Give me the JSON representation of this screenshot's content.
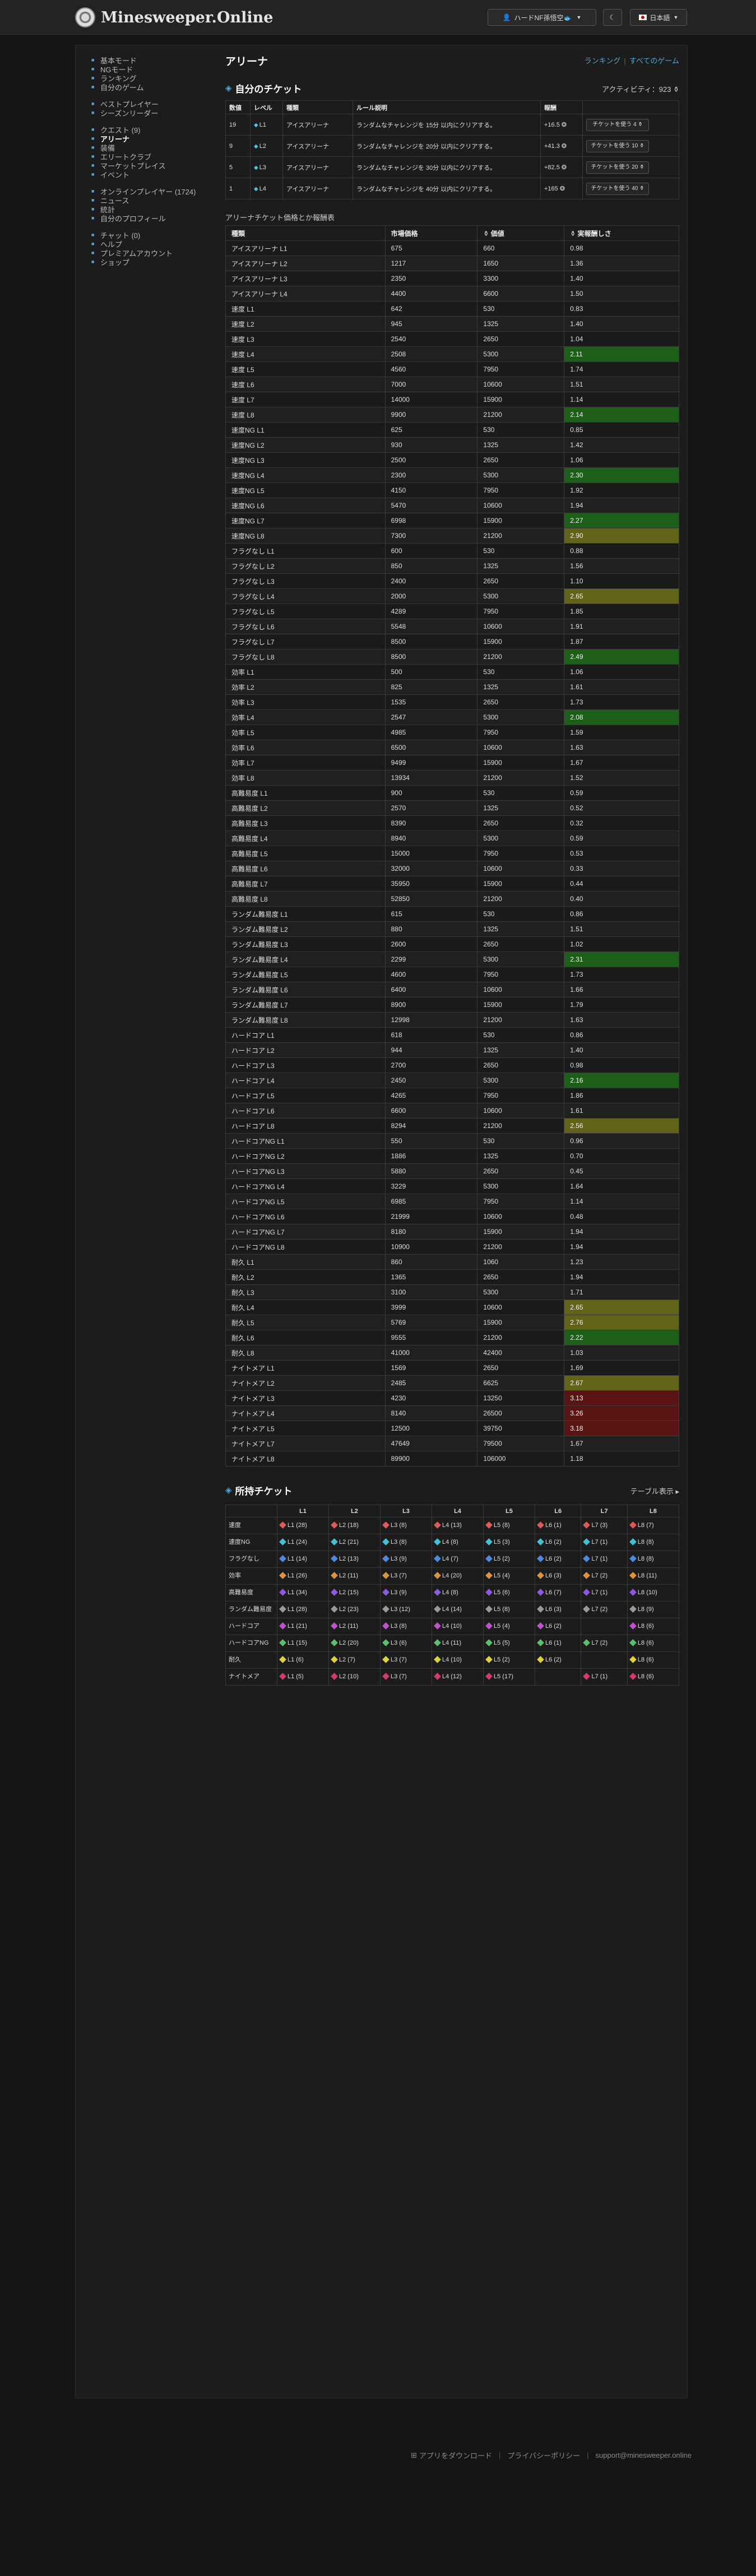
{
  "header": {
    "site_name": "Minesweeper.Online",
    "user_label": "ハードNF孫悟空🐟",
    "theme_icon": "moon-icon",
    "lang_label": "日本語"
  },
  "sidebar": {
    "groups": [
      [
        {
          "label": "基本モード",
          "icon": "bullet"
        },
        {
          "label": "NGモード",
          "icon": "bullet"
        },
        {
          "label": "ランキング",
          "icon": "bullet"
        },
        {
          "label": "自分のゲーム",
          "icon": "bullet"
        }
      ],
      [
        {
          "label": "ベストプレイヤー",
          "icon": "bullet"
        },
        {
          "label": "シーズンリーダー",
          "icon": "bullet"
        }
      ],
      [
        {
          "label": "クエスト (9)",
          "icon": "bullet"
        },
        {
          "label": "アリーナ",
          "icon": "bullet",
          "active": true
        },
        {
          "label": "装備",
          "icon": "bullet"
        },
        {
          "label": "エリートクラブ",
          "icon": "bullet"
        },
        {
          "label": "マーケットプレイス",
          "icon": "bullet"
        },
        {
          "label": "イベント",
          "icon": "bullet"
        }
      ],
      [
        {
          "label": "オンラインプレイヤー (1724)",
          "icon": "bullet"
        },
        {
          "label": "ニュース",
          "icon": "bullet"
        },
        {
          "label": "統計",
          "icon": "bullet"
        },
        {
          "label": "自分のプロフィール",
          "icon": "bullet"
        }
      ],
      [
        {
          "label": "チャット (0)",
          "icon": "bullet"
        },
        {
          "label": "ヘルプ",
          "icon": "bullet"
        },
        {
          "label": "プレミアムアカウント",
          "icon": "bullet"
        },
        {
          "label": "ショップ",
          "icon": "bullet"
        }
      ]
    ]
  },
  "main": {
    "page_title": "アリーナ",
    "links": {
      "ranking": "ランキング",
      "sep": "|",
      "all_games": "すべてのゲーム"
    },
    "my_tickets_title": "自分のチケット",
    "activity": "アクティビティ：923 ⚱",
    "quest_headers": [
      "数値",
      "レベル",
      "種類",
      "ルール説明",
      "報酬",
      ""
    ],
    "quests": [
      {
        "num": "19",
        "level": "L1",
        "kind": "アイスアリーナ",
        "desc": "ランダムなチャレンジを 15分 以内にクリアする。",
        "reward": "+16.5",
        "button": "チケットを使う 4 ⚱"
      },
      {
        "num": "9",
        "level": "L2",
        "kind": "アイスアリーナ",
        "desc": "ランダムなチャレンジを 20分 以内にクリアする。",
        "reward": "+41.3",
        "button": "チケットを使う 10 ⚱"
      },
      {
        "num": "5",
        "level": "L3",
        "kind": "アイスアリーナ",
        "desc": "ランダムなチャレンジを 30分 以内にクリアする。",
        "reward": "+82.5",
        "button": "チケットを使う 20 ⚱"
      },
      {
        "num": "1",
        "level": "L4",
        "kind": "アイスアリーナ",
        "desc": "ランダムなチャレンジを 40分 以内にクリアする。",
        "reward": "+165",
        "button": "チケットを使う 40 ⚱"
      }
    ],
    "ratio_subtitle": "アリーナチケット価格とか報酬表",
    "ratio_headers": [
      "種類",
      "市場価格",
      "⚱ 価値",
      "⚱ 実報酬しさ"
    ],
    "ratio_rows": [
      [
        "アイスアリーナ L1",
        "675",
        "660",
        "0.98",
        ""
      ],
      [
        "アイスアリーナ L2",
        "1217",
        "1650",
        "1.36",
        ""
      ],
      [
        "アイスアリーナ L3",
        "2350",
        "3300",
        "1.40",
        ""
      ],
      [
        "アイスアリーナ L4",
        "4400",
        "6600",
        "1.50",
        ""
      ],
      [
        "速度 L1",
        "642",
        "530",
        "0.83",
        ""
      ],
      [
        "速度 L2",
        "945",
        "1325",
        "1.40",
        ""
      ],
      [
        "速度 L3",
        "2540",
        "2650",
        "1.04",
        ""
      ],
      [
        "速度 L4",
        "2508",
        "5300",
        "2.11",
        "green"
      ],
      [
        "速度 L5",
        "4560",
        "7950",
        "1.74",
        ""
      ],
      [
        "速度 L6",
        "7000",
        "10600",
        "1.51",
        ""
      ],
      [
        "速度 L7",
        "14000",
        "15900",
        "1.14",
        ""
      ],
      [
        "速度 L8",
        "9900",
        "21200",
        "2.14",
        "green"
      ],
      [
        "速度NG L1",
        "625",
        "530",
        "0.85",
        ""
      ],
      [
        "速度NG L2",
        "930",
        "1325",
        "1.42",
        ""
      ],
      [
        "速度NG L3",
        "2500",
        "2650",
        "1.06",
        ""
      ],
      [
        "速度NG L4",
        "2300",
        "5300",
        "2.30",
        "green"
      ],
      [
        "速度NG L5",
        "4150",
        "7950",
        "1.92",
        ""
      ],
      [
        "速度NG L6",
        "5470",
        "10600",
        "1.94",
        ""
      ],
      [
        "速度NG L7",
        "6998",
        "15900",
        "2.27",
        "green"
      ],
      [
        "速度NG L8",
        "7300",
        "21200",
        "2.90",
        "olive"
      ],
      [
        "フラグなし L1",
        "600",
        "530",
        "0.88",
        ""
      ],
      [
        "フラグなし L2",
        "850",
        "1325",
        "1.56",
        ""
      ],
      [
        "フラグなし L3",
        "2400",
        "2650",
        "1.10",
        ""
      ],
      [
        "フラグなし L4",
        "2000",
        "5300",
        "2.65",
        "olive"
      ],
      [
        "フラグなし L5",
        "4289",
        "7950",
        "1.85",
        ""
      ],
      [
        "フラグなし L6",
        "5548",
        "10600",
        "1.91",
        ""
      ],
      [
        "フラグなし L7",
        "8500",
        "15900",
        "1.87",
        ""
      ],
      [
        "フラグなし L8",
        "8500",
        "21200",
        "2.49",
        "green"
      ],
      [
        "効率 L1",
        "500",
        "530",
        "1.06",
        ""
      ],
      [
        "効率 L2",
        "825",
        "1325",
        "1.61",
        ""
      ],
      [
        "効率 L3",
        "1535",
        "2650",
        "1.73",
        ""
      ],
      [
        "効率 L4",
        "2547",
        "5300",
        "2.08",
        "green"
      ],
      [
        "効率 L5",
        "4985",
        "7950",
        "1.59",
        ""
      ],
      [
        "効率 L6",
        "6500",
        "10600",
        "1.63",
        ""
      ],
      [
        "効率 L7",
        "9499",
        "15900",
        "1.67",
        ""
      ],
      [
        "効率 L8",
        "13934",
        "21200",
        "1.52",
        ""
      ],
      [
        "高難易度 L1",
        "900",
        "530",
        "0.59",
        ""
      ],
      [
        "高難易度 L2",
        "2570",
        "1325",
        "0.52",
        ""
      ],
      [
        "高難易度 L3",
        "8390",
        "2650",
        "0.32",
        ""
      ],
      [
        "高難易度 L4",
        "8940",
        "5300",
        "0.59",
        ""
      ],
      [
        "高難易度 L5",
        "15000",
        "7950",
        "0.53",
        ""
      ],
      [
        "高難易度 L6",
        "32000",
        "10600",
        "0.33",
        ""
      ],
      [
        "高難易度 L7",
        "35950",
        "15900",
        "0.44",
        ""
      ],
      [
        "高難易度 L8",
        "52850",
        "21200",
        "0.40",
        ""
      ],
      [
        "ランダム難易度 L1",
        "615",
        "530",
        "0.86",
        ""
      ],
      [
        "ランダム難易度 L2",
        "880",
        "1325",
        "1.51",
        ""
      ],
      [
        "ランダム難易度 L3",
        "2600",
        "2650",
        "1.02",
        ""
      ],
      [
        "ランダム難易度 L4",
        "2299",
        "5300",
        "2.31",
        "green"
      ],
      [
        "ランダム難易度 L5",
        "4600",
        "7950",
        "1.73",
        ""
      ],
      [
        "ランダム難易度 L6",
        "6400",
        "10600",
        "1.66",
        ""
      ],
      [
        "ランダム難易度 L7",
        "8900",
        "15900",
        "1.79",
        ""
      ],
      [
        "ランダム難易度 L8",
        "12998",
        "21200",
        "1.63",
        ""
      ],
      [
        "ハードコア L1",
        "618",
        "530",
        "0.86",
        ""
      ],
      [
        "ハードコア L2",
        "944",
        "1325",
        "1.40",
        ""
      ],
      [
        "ハードコア L3",
        "2700",
        "2650",
        "0.98",
        ""
      ],
      [
        "ハードコア L4",
        "2450",
        "5300",
        "2.16",
        "green"
      ],
      [
        "ハードコア L5",
        "4265",
        "7950",
        "1.86",
        ""
      ],
      [
        "ハードコア L6",
        "6600",
        "10600",
        "1.61",
        ""
      ],
      [
        "ハードコア L8",
        "8294",
        "21200",
        "2.56",
        "olive"
      ],
      [
        "ハードコアNG L1",
        "550",
        "530",
        "0.96",
        ""
      ],
      [
        "ハードコアNG L2",
        "1886",
        "1325",
        "0.70",
        ""
      ],
      [
        "ハードコアNG L3",
        "5880",
        "2650",
        "0.45",
        ""
      ],
      [
        "ハードコアNG L4",
        "3229",
        "5300",
        "1.64",
        ""
      ],
      [
        "ハードコアNG L5",
        "6985",
        "7950",
        "1.14",
        ""
      ],
      [
        "ハードコアNG L6",
        "21999",
        "10600",
        "0.48",
        ""
      ],
      [
        "ハードコアNG L7",
        "8180",
        "15900",
        "1.94",
        ""
      ],
      [
        "ハードコアNG L8",
        "10900",
        "21200",
        "1.94",
        ""
      ],
      [
        "耐久 L1",
        "860",
        "1060",
        "1.23",
        ""
      ],
      [
        "耐久 L2",
        "1365",
        "2650",
        "1.94",
        ""
      ],
      [
        "耐久 L3",
        "3100",
        "5300",
        "1.71",
        ""
      ],
      [
        "耐久 L4",
        "3999",
        "10600",
        "2.65",
        "olive"
      ],
      [
        "耐久 L5",
        "5769",
        "15900",
        "2.76",
        "olive"
      ],
      [
        "耐久 L6",
        "9555",
        "21200",
        "2.22",
        "green"
      ],
      [
        "耐久 L8",
        "41000",
        "42400",
        "1.03",
        ""
      ],
      [
        "ナイトメア L1",
        "1569",
        "2650",
        "1.69",
        ""
      ],
      [
        "ナイトメア L2",
        "2485",
        "6625",
        "2.67",
        "olive"
      ],
      [
        "ナイトメア L3",
        "4230",
        "13250",
        "3.13",
        "red"
      ],
      [
        "ナイトメア L4",
        "8140",
        "26500",
        "3.26",
        "red"
      ],
      [
        "ナイトメア L5",
        "12500",
        "39750",
        "3.18",
        "red"
      ],
      [
        "ナイトメア L7",
        "47649",
        "79500",
        "1.67",
        ""
      ],
      [
        "ナイトメア L8",
        "89900",
        "106000",
        "1.18",
        ""
      ]
    ],
    "owned_title": "所持チケット",
    "table_view": "テーブル表示 ▸",
    "owned_headers": [
      "",
      "L1",
      "L2",
      "L3",
      "L4",
      "L5",
      "L6",
      "L7",
      "L8"
    ],
    "owned_rows": [
      {
        "name": "速度",
        "color": "#e05a5a",
        "cells": [
          "L1 (28)",
          "L2 (18)",
          "L3 (8)",
          "L4 (13)",
          "L5 (8)",
          "L6 (1)",
          "L7 (3)",
          "L8 (7)"
        ]
      },
      {
        "name": "速度NG",
        "color": "#3fc1d6",
        "cells": [
          "L1 (24)",
          "L2 (21)",
          "L3 (8)",
          "L4 (8)",
          "L5 (3)",
          "L6 (2)",
          "L7 (1)",
          "L8 (8)"
        ]
      },
      {
        "name": "フラグなし",
        "color": "#4a8be0",
        "cells": [
          "L1 (14)",
          "L2 (13)",
          "L3 (9)",
          "L4 (7)",
          "L5 (2)",
          "L6 (2)",
          "L7 (1)",
          "L8 (8)"
        ]
      },
      {
        "name": "効率",
        "color": "#e0913a",
        "cells": [
          "L1 (26)",
          "L2 (11)",
          "L3 (7)",
          "L4 (20)",
          "L5 (4)",
          "L6 (3)",
          "L7 (2)",
          "L8 (11)"
        ]
      },
      {
        "name": "高難易度",
        "color": "#8c5ae0",
        "cells": [
          "L1 (34)",
          "L2 (15)",
          "L3 (9)",
          "L4 (8)",
          "L5 (6)",
          "L6 (7)",
          "L7 (1)",
          "L8 (10)"
        ]
      },
      {
        "name": "ランダム難易度",
        "color": "#9a9a9a",
        "cells": [
          "L1 (28)",
          "L2 (23)",
          "L3 (12)",
          "L4 (14)",
          "L5 (8)",
          "L6 (3)",
          "L7 (2)",
          "L8 (9)"
        ]
      },
      {
        "name": "ハードコア",
        "color": "#c24fd0",
        "cells": [
          "L1 (21)",
          "L2 (11)",
          "L3 (8)",
          "L4 (10)",
          "L5 (4)",
          "L6 (2)",
          "",
          "L8 (6)"
        ]
      },
      {
        "name": "ハードコアNG",
        "color": "#56c46a",
        "cells": [
          "L1 (15)",
          "L2 (20)",
          "L3 (6)",
          "L4 (11)",
          "L5 (5)",
          "L6 (1)",
          "L7 (2)",
          "L8 (6)"
        ]
      },
      {
        "name": "耐久",
        "color": "#e0d23a",
        "cells": [
          "L1 (6)",
          "L2 (7)",
          "L3 (7)",
          "L4 (10)",
          "L5 (2)",
          "L6 (2)",
          "",
          "L8 (6)"
        ]
      },
      {
        "name": "ナイトメア",
        "color": "#d63a6a",
        "cells": [
          "L1 (5)",
          "L2 (10)",
          "L3 (7)",
          "L4 (12)",
          "L5 (17)",
          "",
          "L7 (1)",
          "L8 (6)"
        ]
      }
    ]
  },
  "footer": {
    "download": "アプリをダウンロード",
    "privacy": "プライバシーポリシー",
    "email": "support@minesweeper.online"
  }
}
